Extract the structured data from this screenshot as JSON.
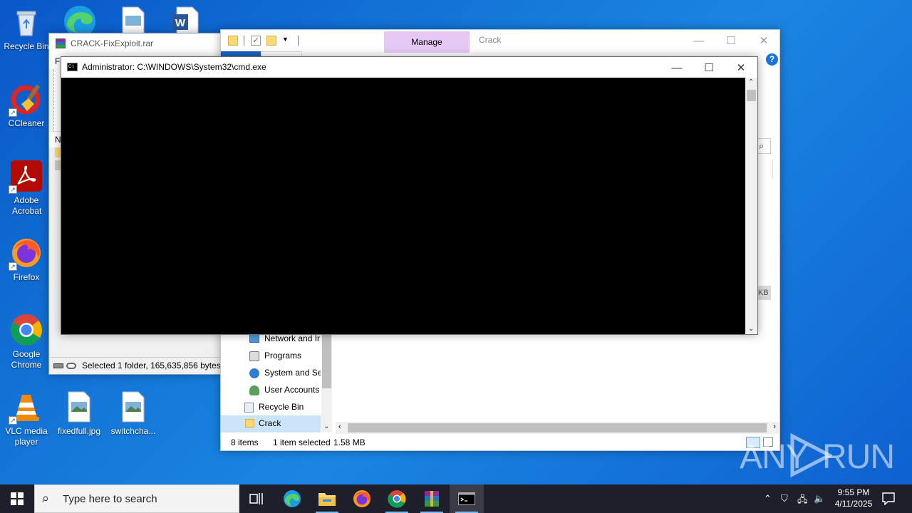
{
  "desktop": {
    "icons": [
      {
        "label": "Recycle Bin"
      },
      {
        "label": "CCleaner"
      },
      {
        "label": "Adobe Acrobat"
      },
      {
        "label": "Firefox"
      },
      {
        "label": "Google Chrome"
      },
      {
        "label": "VLC media player"
      },
      {
        "label": "fixedfull.jpg"
      },
      {
        "label": "switchcha..."
      }
    ]
  },
  "winrar": {
    "title": "CRACK-FixExploit.rar",
    "menu_partial": "Fi",
    "column_partial": "N",
    "status": "Selected 1 folder, 165,635,856 bytes"
  },
  "explorer": {
    "ribbon_tab_manage": "Manage",
    "title": "Crack",
    "nav_items": [
      {
        "label": "Network and Ir",
        "icon": "network-icon"
      },
      {
        "label": "Programs",
        "icon": "programs-icon"
      },
      {
        "label": "System and Se",
        "icon": "system-security-icon"
      },
      {
        "label": "User Accounts",
        "icon": "user-accounts-icon"
      },
      {
        "label": "Recycle Bin",
        "icon": "recycle-bin-icon"
      },
      {
        "label": "Crack",
        "icon": "folder-icon",
        "selected": true
      }
    ],
    "status_items": "8 items",
    "status_selected": "1 item selected",
    "status_size": "1.58 MB",
    "size_partial": "KB",
    "help_label": "?"
  },
  "cmd": {
    "title": "Administrator: C:\\WINDOWS\\System32\\cmd.exe"
  },
  "taskbar": {
    "search_placeholder": "Type here to search",
    "time": "9:55 PM",
    "date": "4/11/2025"
  },
  "watermark": {
    "left": "ANY",
    "right": "RUN"
  }
}
